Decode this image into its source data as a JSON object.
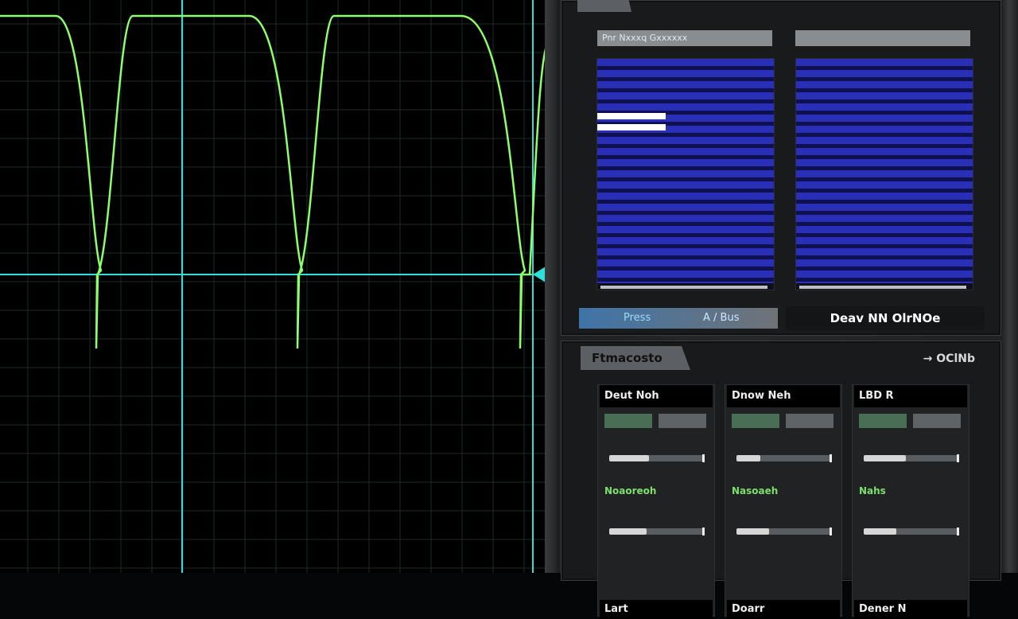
{
  "scope": {
    "trace_color": "#8dff6a",
    "cursor_color": "#2fe0d8",
    "grid_color": "#1c2a2a"
  },
  "top": {
    "tab_label": "",
    "corner_text": "",
    "list_left_header": "Pnr Nxxxq Gxxxxxx",
    "list_right_header": "",
    "strip_left": "Press",
    "strip_right": "A / Bus",
    "wide_button": "Deav NN OlrNOe"
  },
  "bottom": {
    "tab_label": "Ftmacosto",
    "corner_text": "→ OClNb",
    "channels": [
      {
        "header": "Deut Noh",
        "btn_a": "",
        "btn_b": "",
        "green": "Noaoreoh",
        "footer": "Lart",
        "slider1": 0.42,
        "slider2": 0.4
      },
      {
        "header": "Dnow Neh",
        "btn_a": "",
        "btn_b": "",
        "green": "Nasoaeh",
        "footer": "Doarr",
        "slider1": 0.25,
        "slider2": 0.35
      },
      {
        "header": "LBD R",
        "btn_a": "",
        "btn_b": "",
        "green": "Nahs",
        "footer": "Dener N",
        "slider1": 0.45,
        "slider2": 0.35
      }
    ]
  },
  "colors": {
    "accent_blue": "#2a2fb8",
    "panel_bg": "#181a1b"
  }
}
